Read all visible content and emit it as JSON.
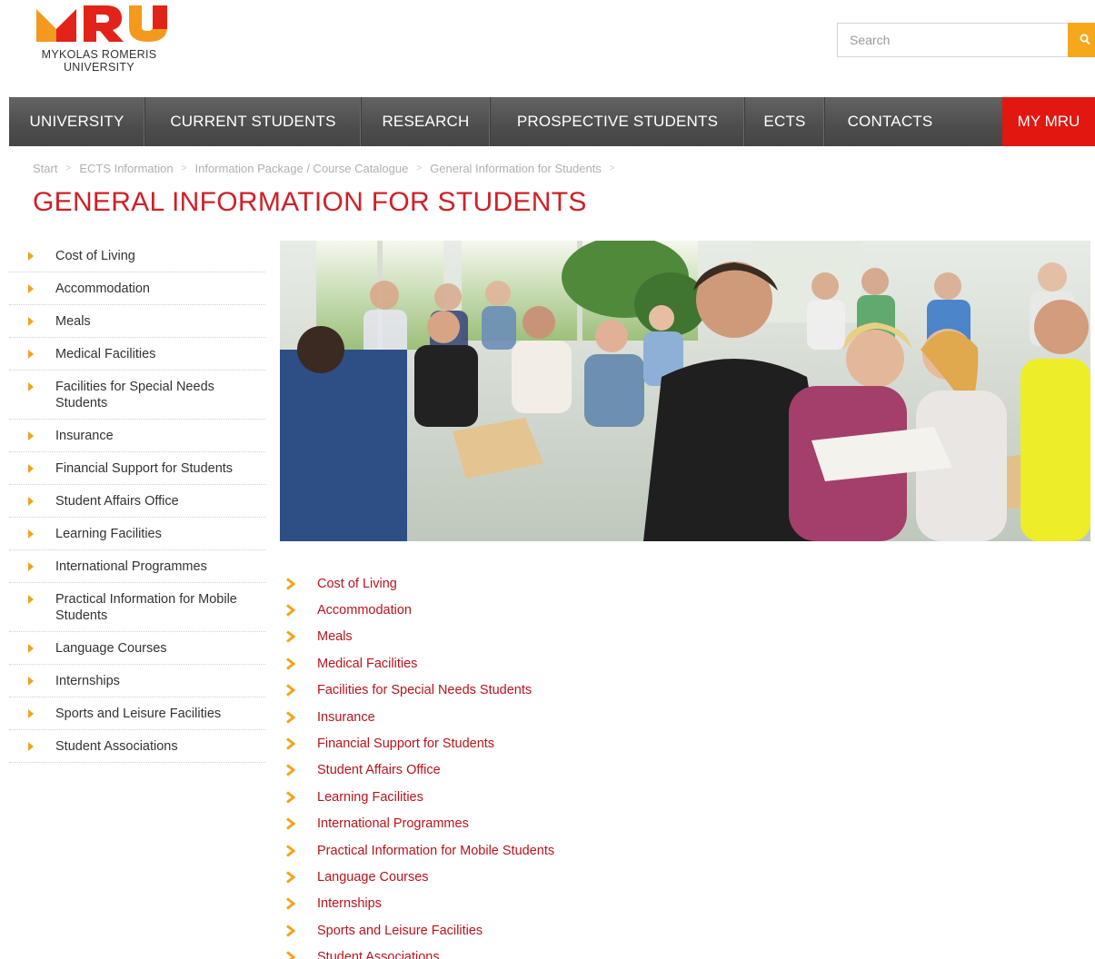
{
  "logo": {
    "line1": "MYKOLAS ROMERIS",
    "line2": "UNIVERSITY",
    "colors": {
      "orange": "#f39a1e",
      "red": "#e2231a"
    }
  },
  "search": {
    "placeholder": "Search",
    "icon": "search-icon"
  },
  "nav": {
    "items": [
      {
        "label": "UNIVERSITY"
      },
      {
        "label": "CURRENT STUDENTS"
      },
      {
        "label": "RESEARCH"
      },
      {
        "label": "PROSPECTIVE STUDENTS"
      },
      {
        "label": "ECTS"
      },
      {
        "label": "CONTACTS"
      }
    ],
    "my_label": "MY MRU"
  },
  "breadcrumb": [
    "Start",
    "ECTS Information",
    "Information Package / Course Catalogue",
    "General Information for Students"
  ],
  "page_title": "GENERAL INFORMATION FOR STUDENTS",
  "sidebar": {
    "items": [
      "Cost of Living",
      "Accommodation",
      "Meals",
      "Medical Facilities",
      "Facilities for Special Needs Students",
      "Insurance",
      "Financial Support for Students",
      "Student Affairs Office",
      "Learning Facilities",
      "International Programmes",
      "Practical Information for Mobile Students",
      "Language Courses",
      "Internships",
      "Sports and Leisure Facilities",
      "Student Associations"
    ]
  },
  "links": [
    "Cost of Living",
    "Accommodation",
    "Meals",
    "Medical Facilities",
    "Facilities for Special Needs Students",
    "Insurance",
    "Financial Support for Students",
    "Student Affairs Office",
    "Learning Facilities",
    "International Programmes",
    "Practical Information for Mobile Students",
    "Language Courses",
    "Internships",
    "Sports and Leisure Facilities",
    "Student Associations"
  ],
  "colors": {
    "accent_red": "#cf2029",
    "link_red": "#b8141c",
    "arrow_orange": "#f0a31d",
    "nav_bg": "#4d4d4d",
    "my_mru_bg": "#e2170f"
  }
}
